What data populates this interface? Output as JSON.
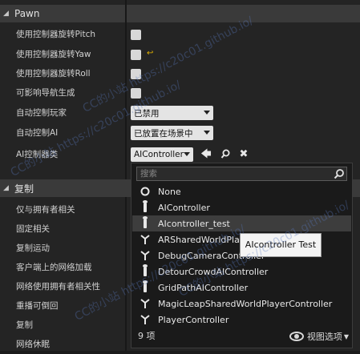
{
  "pawn_section": {
    "title": "Pawn"
  },
  "pawn_rows": [
    {
      "label": "使用控制器旋转Pitch"
    },
    {
      "label": "使用控制器旋转Yaw"
    },
    {
      "label": "使用控制器旋转Roll"
    },
    {
      "label": "可影响导航生成"
    },
    {
      "label": "自动控制玩家",
      "value": "已禁用"
    },
    {
      "label": "自动控制AI",
      "value": "已放置在场景中"
    },
    {
      "label": "AI控制器类",
      "value": "AIController"
    }
  ],
  "replication_section": {
    "title": "复制"
  },
  "replication_rows": [
    {
      "label": "仅与拥有者相关"
    },
    {
      "label": "固定相关"
    },
    {
      "label": "复制运动"
    },
    {
      "label": "客户端上的网络加载"
    },
    {
      "label": "网络使用拥有者相关性"
    },
    {
      "label": "重播可倒回"
    },
    {
      "label": "复制"
    },
    {
      "label": "网络休眠"
    }
  ],
  "dropdown": {
    "search_placeholder": "搜索",
    "items": [
      {
        "label": "None"
      },
      {
        "label": "AIController"
      },
      {
        "label": "AIcontroller_test"
      },
      {
        "label": "ARSharedWorldPlayerController"
      },
      {
        "label": "DebugCameraController"
      },
      {
        "label": "DetourCrowdAIController"
      },
      {
        "label": "GridPathAIController"
      },
      {
        "label": "MagicLeapSharedWorldPlayerController"
      },
      {
        "label": "PlayerController"
      }
    ],
    "count": "9 项",
    "view_options": "视图选项"
  },
  "tooltip": {
    "text": "AIcontroller Test"
  },
  "watermark": {
    "text": "CC的小站 https://c20c01.github.io/"
  },
  "colors": {
    "accent_reset": "#e0b000",
    "highlight_row": "#3d3d3d"
  }
}
